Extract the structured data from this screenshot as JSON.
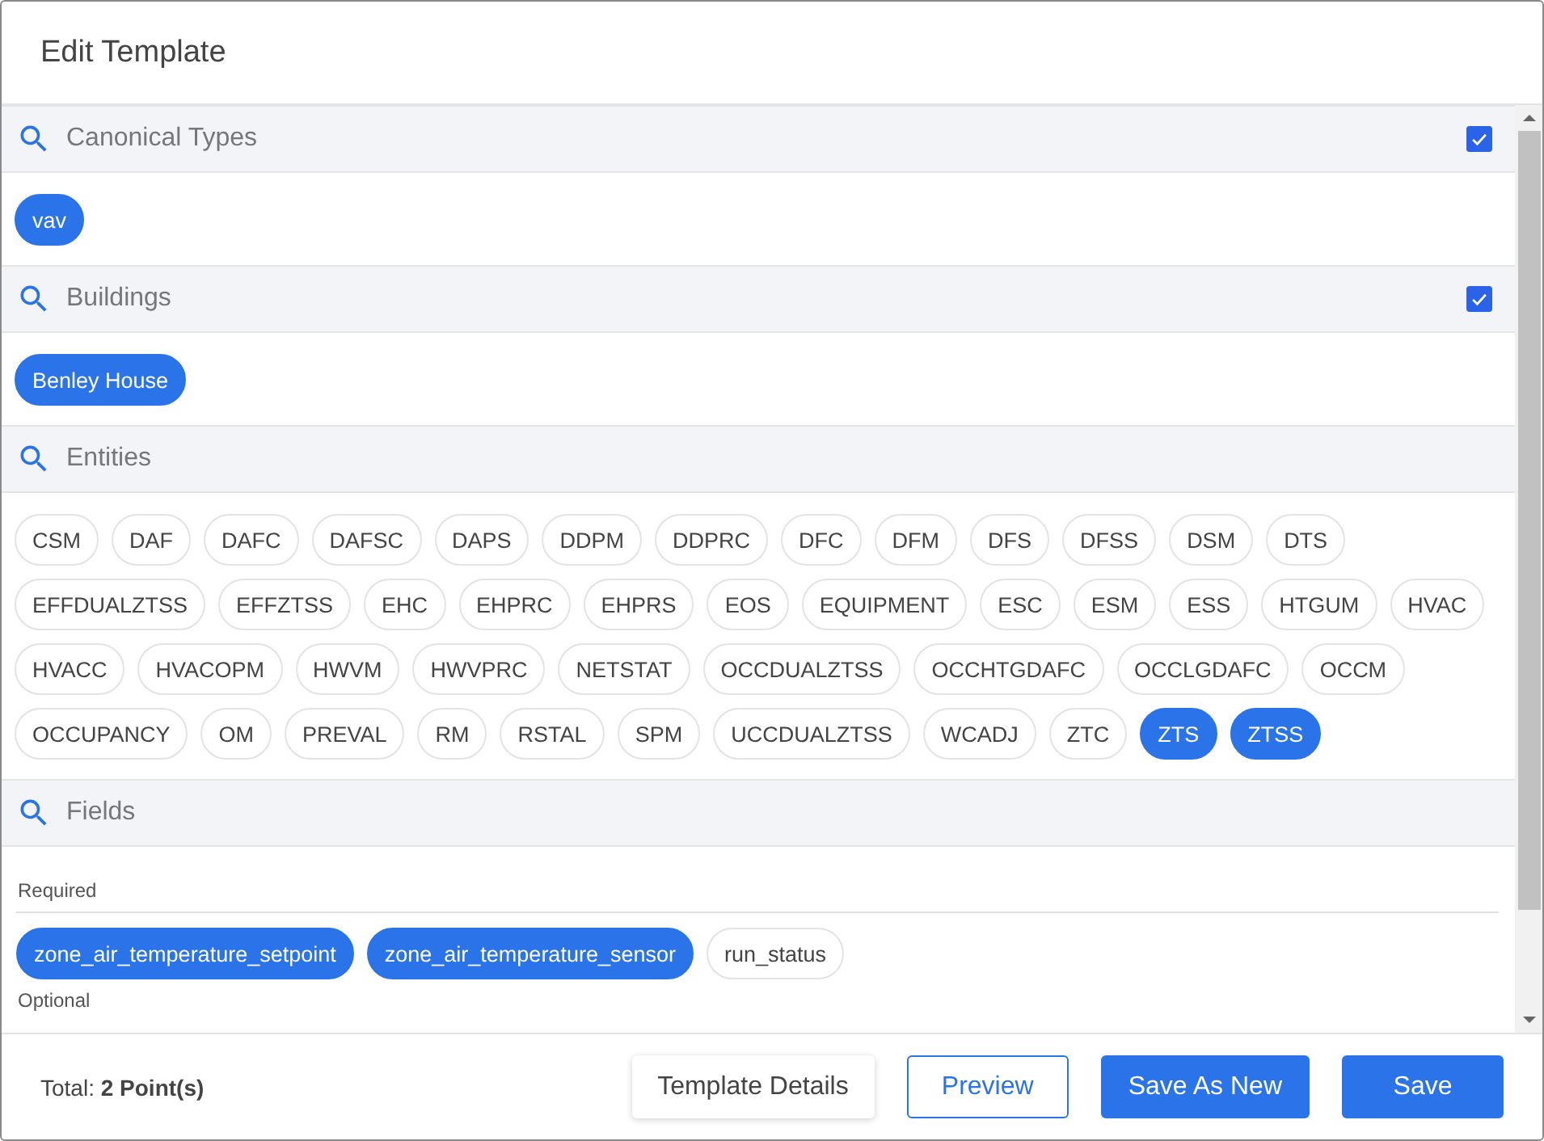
{
  "dialog": {
    "title": "Edit Template"
  },
  "sections": [
    {
      "title": "Canonical Types",
      "checked": true,
      "chips": [
        {
          "label": "vav",
          "selected": true
        }
      ]
    },
    {
      "title": "Buildings",
      "checked": true,
      "chips": [
        {
          "label": "Benley House",
          "selected": true
        }
      ]
    },
    {
      "title": "Entities",
      "chips": [
        {
          "label": "CSM",
          "selected": false
        },
        {
          "label": "DAF",
          "selected": false
        },
        {
          "label": "DAFC",
          "selected": false
        },
        {
          "label": "DAFSC",
          "selected": false
        },
        {
          "label": "DAPS",
          "selected": false
        },
        {
          "label": "DDPM",
          "selected": false
        },
        {
          "label": "DDPRC",
          "selected": false
        },
        {
          "label": "DFC",
          "selected": false
        },
        {
          "label": "DFM",
          "selected": false
        },
        {
          "label": "DFS",
          "selected": false
        },
        {
          "label": "DFSS",
          "selected": false
        },
        {
          "label": "DSM",
          "selected": false
        },
        {
          "label": "DTS",
          "selected": false
        },
        {
          "label": "EFFDUALZTSS",
          "selected": false
        },
        {
          "label": "EFFZTSS",
          "selected": false
        },
        {
          "label": "EHC",
          "selected": false
        },
        {
          "label": "EHPRC",
          "selected": false
        },
        {
          "label": "EHPRS",
          "selected": false
        },
        {
          "label": "EOS",
          "selected": false
        },
        {
          "label": "EQUIPMENT",
          "selected": false
        },
        {
          "label": "ESC",
          "selected": false
        },
        {
          "label": "ESM",
          "selected": false
        },
        {
          "label": "ESS",
          "selected": false
        },
        {
          "label": "HTGUM",
          "selected": false
        },
        {
          "label": "HVAC",
          "selected": false
        },
        {
          "label": "HVACC",
          "selected": false
        },
        {
          "label": "HVACOPM",
          "selected": false
        },
        {
          "label": "HWVM",
          "selected": false
        },
        {
          "label": "HWVPRC",
          "selected": false
        },
        {
          "label": "NETSTAT",
          "selected": false
        },
        {
          "label": "OCCDUALZTSS",
          "selected": false
        },
        {
          "label": "OCCHTGDAFC",
          "selected": false
        },
        {
          "label": "OCCLGDAFC",
          "selected": false
        },
        {
          "label": "OCCM",
          "selected": false
        },
        {
          "label": "OCCUPANCY",
          "selected": false
        },
        {
          "label": "OM",
          "selected": false
        },
        {
          "label": "PREVAL",
          "selected": false
        },
        {
          "label": "RM",
          "selected": false
        },
        {
          "label": "RSTAL",
          "selected": false
        },
        {
          "label": "SPM",
          "selected": false
        },
        {
          "label": "UCCDUALZTSS",
          "selected": false
        },
        {
          "label": "WCADJ",
          "selected": false
        },
        {
          "label": "ZTC",
          "selected": false
        },
        {
          "label": "ZTS",
          "selected": true
        },
        {
          "label": "ZTSS",
          "selected": true
        }
      ]
    },
    {
      "title": "Fields",
      "groups": [
        {
          "label": "Required",
          "chips": [
            {
              "label": "zone_air_temperature_setpoint",
              "selected": true
            },
            {
              "label": "zone_air_temperature_sensor",
              "selected": true
            },
            {
              "label": "run_status",
              "selected": false
            }
          ]
        },
        {
          "label": "Optional"
        }
      ]
    }
  ],
  "footer": {
    "total": "Total: **2 Point(s)**",
    "buttons": [
      {
        "label": "Template Details",
        "kind": "secondary"
      },
      {
        "label": "Preview",
        "kind": "outlined"
      },
      {
        "label": "Save As New",
        "kind": "primary"
      },
      {
        "label": "Save",
        "kind": "primary"
      }
    ]
  }
}
